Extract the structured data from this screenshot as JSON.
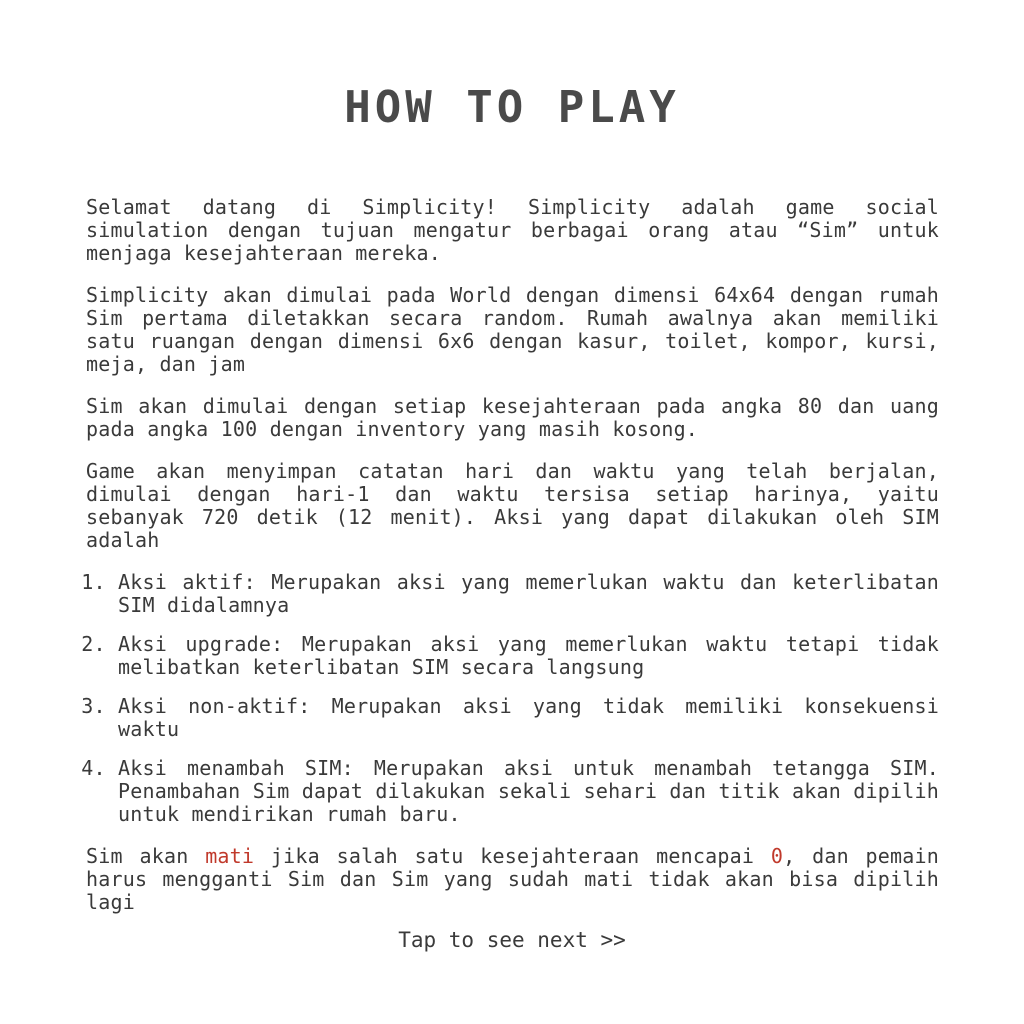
{
  "title": "HOW TO PLAY",
  "paragraphs": [
    "Selamat datang di Simplicity! Simplicity adalah game social simulation dengan tujuan mengatur berbagai orang atau “Sim” untuk menjaga kesejahteraan mereka.",
    "Simplicity akan dimulai pada World dengan dimensi 64x64 dengan rumah Sim pertama diletakkan secara random. Rumah awalnya akan memiliki satu ruangan  dengan dimensi 6x6 dengan kasur, toilet, kompor, kursi, meja, dan jam",
    "Sim akan dimulai dengan setiap kesejahteraan pada angka 80  dan uang pada angka  100 dengan inventory yang masih kosong.",
    "Game akan menyimpan catatan hari dan waktu yang telah berjalan, dimulai dengan  hari-1 dan waktu tersisa setiap harinya, yaitu sebanyak 720 detik (12 menit). Aksi yang dapat dilakukan oleh SIM adalah"
  ],
  "actions": [
    "Aksi aktif: Merupakan aksi yang memerlukan waktu dan keterlibatan SIM didalamnya",
    "Aksi upgrade: Merupakan aksi yang memerlukan waktu tetapi tidak melibatkan keterlibatan SIM secara langsung",
    "Aksi non-aktif: Merupakan aksi yang tidak memiliki konsekuensi waktu",
    "Aksi menambah SIM: Merupakan aksi untuk menambah tetangga SIM. Penambahan Sim dapat dilakukan sekali sehari dan titik akan dipilih untuk mendirikan rumah baru."
  ],
  "death_rule": {
    "part1": "Sim akan ",
    "highlight_word": "mati",
    "part2": " jika salah satu kesejahteraan mencapai ",
    "highlight_number": "0",
    "part3": ", dan pemain harus mengganti Sim dan Sim yang sudah mati tidak akan bisa dipilih lagi"
  },
  "tap_next": "Tap to see next >>",
  "colors": {
    "text": "#3a3a3a",
    "title": "#4a4a4a",
    "highlight": "#c0392b",
    "background": "#ffffff"
  }
}
